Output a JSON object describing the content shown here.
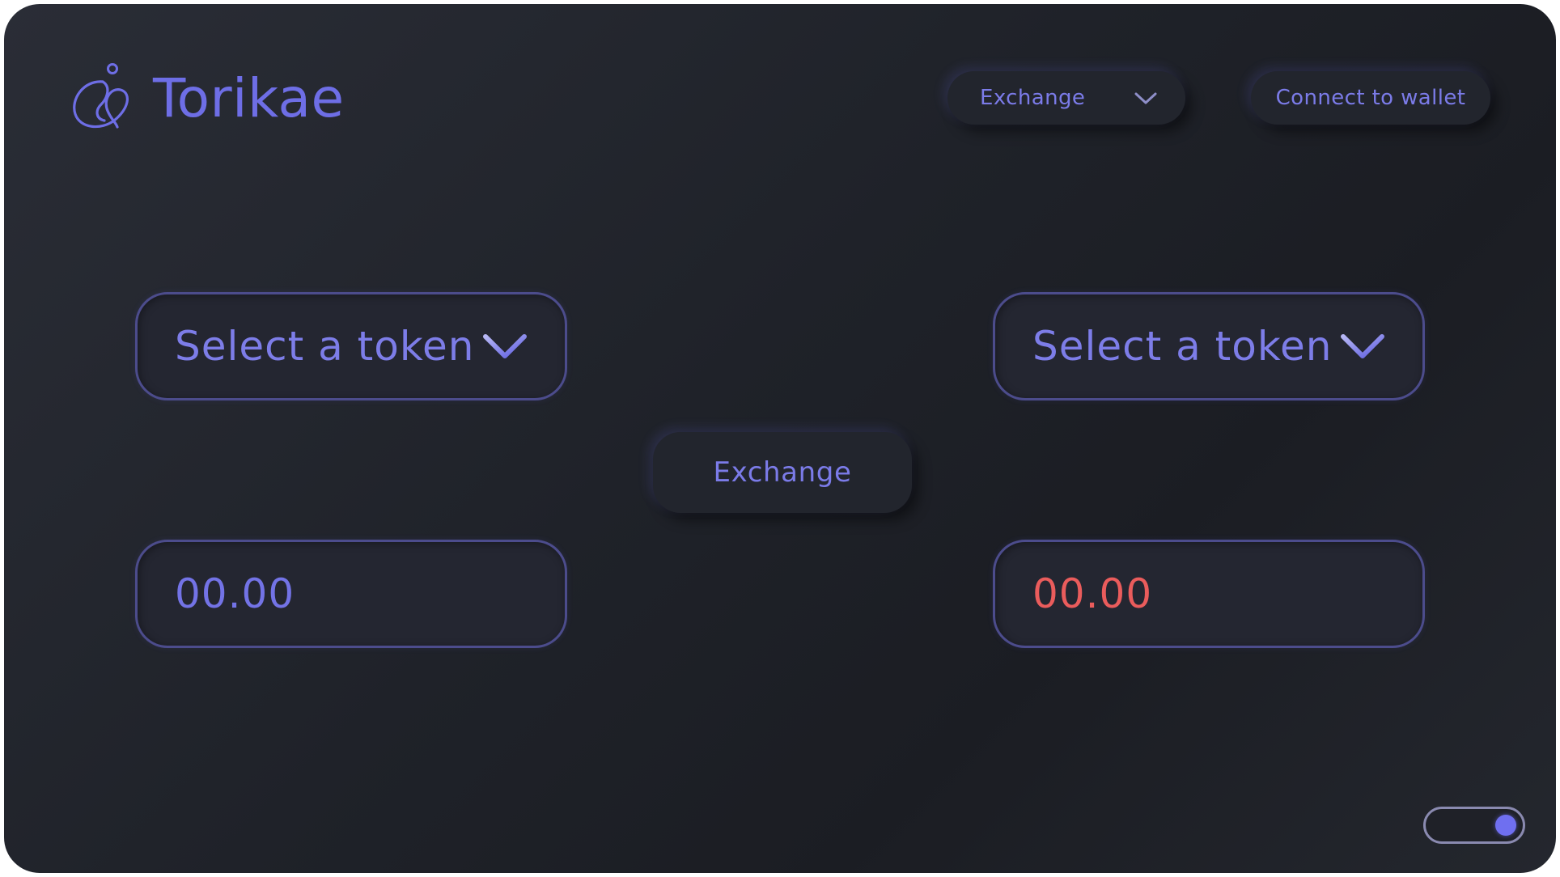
{
  "app": {
    "brand_name": "Torikae",
    "accent_color": "#6e6ee6",
    "negative_color": "#ea5c5c",
    "background_color": "#1f2229"
  },
  "header": {
    "nav_dropdown": {
      "label": "Exchange",
      "icon": "chevron-down-icon"
    },
    "connect_button": {
      "label": "Connect to wallet"
    }
  },
  "swap": {
    "from": {
      "select_label": "Select a token",
      "amount": "00.00"
    },
    "to": {
      "select_label": "Select a token",
      "amount": "00.00"
    },
    "exchange_button": {
      "label": "Exchange"
    }
  },
  "theme_toggle": {
    "state": "on"
  }
}
